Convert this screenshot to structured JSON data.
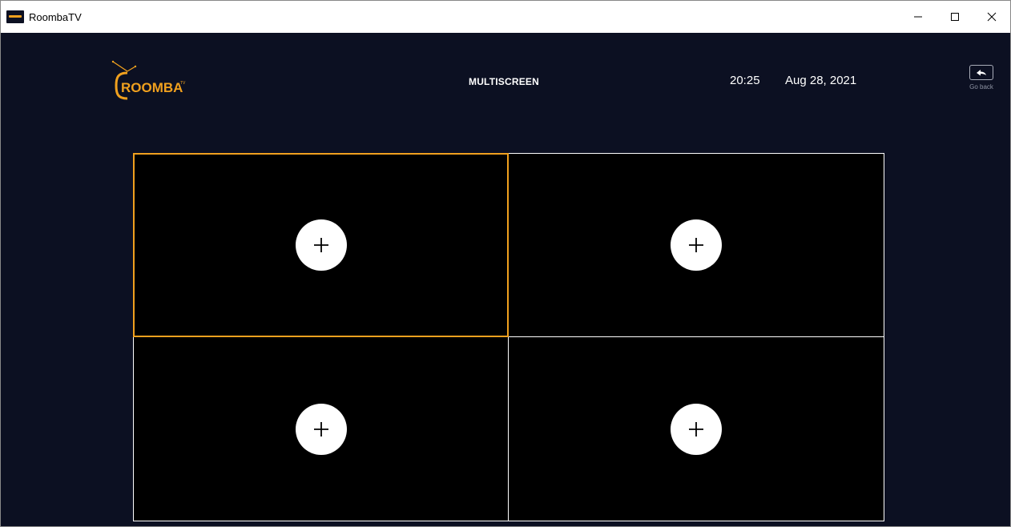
{
  "window": {
    "title": "RoombaTV",
    "controls": [
      "minimize-icon",
      "maximize-icon",
      "close-icon"
    ]
  },
  "header": {
    "logo_text": "ROOMBA",
    "logo_superscript": "TV",
    "title": "MULTISCREEN",
    "time": "20:25",
    "date": "Aug 28, 2021",
    "go_back_label": "Go back",
    "go_back_icon": "undo-arrow-icon"
  },
  "screens": [
    {
      "slot": 1,
      "selected": true,
      "icon": "plus-icon"
    },
    {
      "slot": 2,
      "selected": false,
      "icon": "plus-icon"
    },
    {
      "slot": 3,
      "selected": false,
      "icon": "plus-icon"
    },
    {
      "slot": 4,
      "selected": false,
      "icon": "plus-icon"
    }
  ],
  "colors": {
    "background": "#0c1022",
    "accent": "#f0a01e",
    "screen": "#000000",
    "border": "#ffffff"
  }
}
